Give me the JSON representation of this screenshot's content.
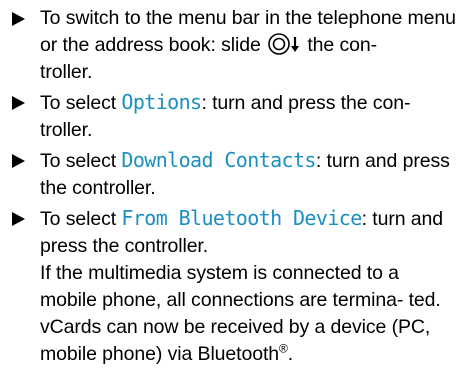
{
  "steps": [
    {
      "text_before": "To switch to the menu bar in the telephone menu or the address book: slide ",
      "icon": "controller-slide-down-icon",
      "text_after": " the con-",
      "text_wrap": "troller."
    },
    {
      "text_before": "To select ",
      "term": "Options",
      "text_after": ": turn and press the con-",
      "text_wrap": "troller."
    },
    {
      "text_before": "To select ",
      "term": "Download Contacts",
      "text_after": ": turn and press the controller."
    },
    {
      "text_before": "To select ",
      "term": "From Bluetooth Device",
      "text_after": ": turn and press the controller.",
      "note_line1": "If the multimedia system is connected to a mobile phone, all connections are termina-",
      "note_line2": "ted. vCards can now be received by a device (PC, mobile phone) via Bluetooth",
      "note_registered": "®",
      "note_end": "."
    }
  ],
  "colors": {
    "text": "#000000",
    "term": "#1a8fc0"
  }
}
